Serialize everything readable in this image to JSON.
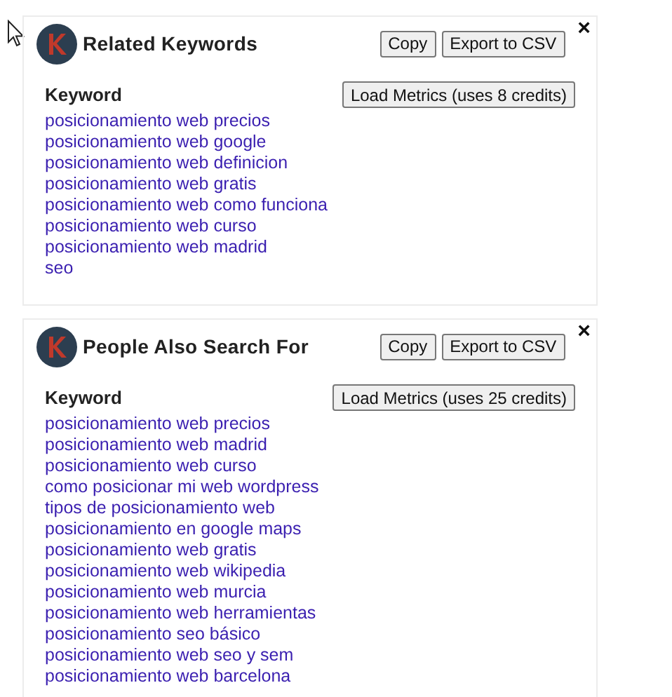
{
  "panels": [
    {
      "title": "Related Keywords",
      "buttons": [
        "Copy",
        "Export to CSV"
      ],
      "close": "×",
      "column": "Keyword",
      "load_metrics": "Load Metrics (uses 8 credits)",
      "keywords": [
        "posicionamiento web precios",
        "posicionamiento web google",
        "posicionamiento web definicion",
        "posicionamiento web gratis",
        "posicionamiento web como funciona",
        "posicionamiento web curso",
        "posicionamiento web madrid",
        "seo"
      ]
    },
    {
      "title": "People Also Search For",
      "buttons": [
        "Copy",
        "Export to CSV"
      ],
      "close": "×",
      "column": "Keyword",
      "load_metrics": "Load Metrics (uses 25 credits)",
      "keywords": [
        "posicionamiento web precios",
        "posicionamiento web madrid",
        "posicionamiento web curso",
        "como posicionar mi web wordpress",
        "tipos de posicionamiento web",
        "posicionamiento en google maps",
        "posicionamiento web gratis",
        "posicionamiento web wikipedia",
        "posicionamiento web murcia",
        "posicionamiento web herramientas",
        "posicionamiento seo básico",
        "posicionamiento web seo y sem",
        "posicionamiento web barcelona"
      ]
    }
  ]
}
